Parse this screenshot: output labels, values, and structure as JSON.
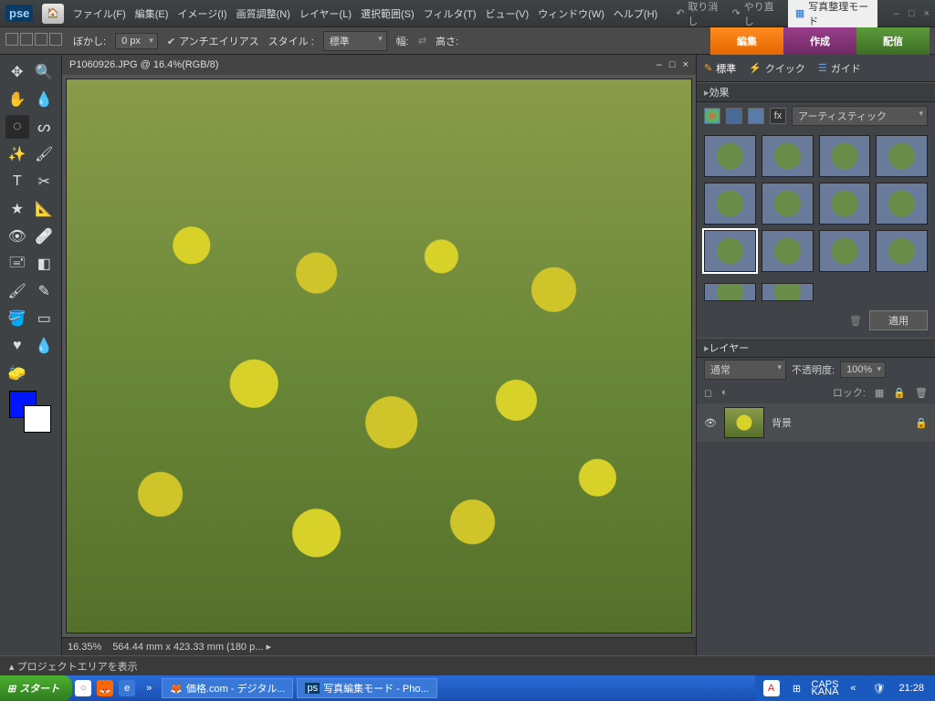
{
  "app_logo": "pse",
  "menu": {
    "file": "ファイル(F)",
    "edit": "編集(E)",
    "image": "イメージ(I)",
    "enhance": "画質調整(N)",
    "layer": "レイヤー(L)",
    "select": "選択範囲(S)",
    "filter": "フィルタ(T)",
    "view": "ビュー(V)",
    "window": "ウィンドウ(W)",
    "help": "ヘルプ(H)"
  },
  "top": {
    "undo": "取り消し",
    "redo": "やり直し",
    "organizer": "写真整理モード"
  },
  "options": {
    "feather_label": "ぼかし:",
    "feather_value": "0 px",
    "antialias": "アンチエイリアス",
    "style_label": "スタイル :",
    "style_value": "標準",
    "width_label": "幅:",
    "height_label": "高さ:"
  },
  "big_tabs": {
    "edit": "編集",
    "create": "作成",
    "share": "配信"
  },
  "doc": {
    "title": "P1060926.JPG @ 16.4%(RGB/8)",
    "zoom": "16.35%",
    "dims": "564.44 mm x 423.33 mm (180 p...   ▸"
  },
  "project_area": "▴ プロジェクトエリアを表示",
  "rpanel": {
    "tab_standard": "標準",
    "tab_quick": "クイック",
    "tab_guided": "ガイド",
    "effects_hdr": "効果",
    "effects_category": "アーティスティック",
    "apply": "適用",
    "layers_hdr": "レイヤー",
    "blend_mode": "通常",
    "opacity_label": "不透明度:",
    "opacity_value": "100%",
    "lock_label": "ロック:",
    "layer0": "背景"
  },
  "taskbar": {
    "start": "スタート",
    "item1": "価格.com - デジタル...",
    "item2": "写真編集モード - Pho...",
    "lang1": "CAPS",
    "lang2": "KANA",
    "clock": "21:28"
  }
}
